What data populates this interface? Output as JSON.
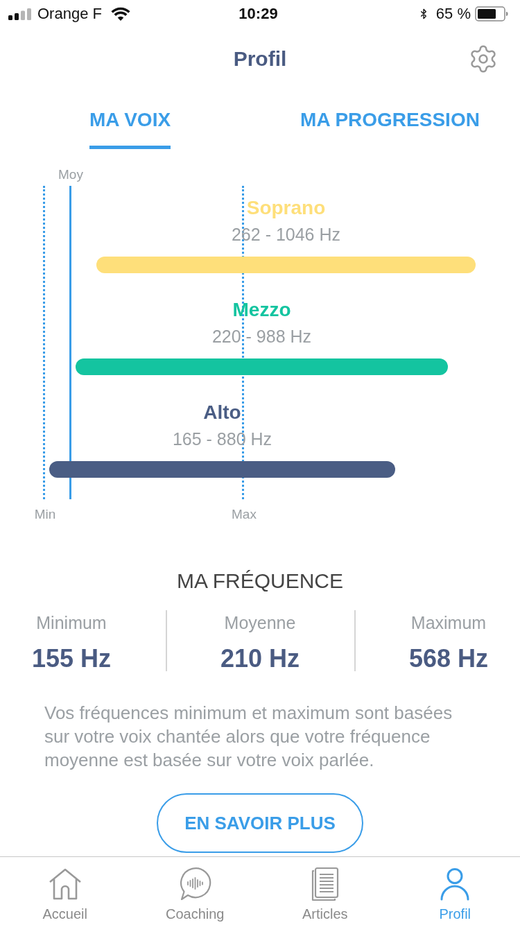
{
  "status_bar": {
    "carrier": "Orange F",
    "time": "10:29",
    "battery": "65 %"
  },
  "header": {
    "title": "Profil"
  },
  "tabs": [
    {
      "label": "MA VOIX",
      "selected": true
    },
    {
      "label": "MA PROGRESSION",
      "selected": false
    }
  ],
  "voice_chart": {
    "markers": [
      {
        "label": "Min",
        "kind": "limit"
      },
      {
        "label": "Moy",
        "kind": "average"
      },
      {
        "label": "Max",
        "kind": "limit"
      }
    ],
    "ranges": [
      {
        "name": "Soprano",
        "range": "262 - 1046 Hz",
        "color": "#fedf7a"
      },
      {
        "name": "Mezzo",
        "range": "220 - 988 Hz",
        "color": "#14c4a0"
      },
      {
        "name": "Alto",
        "range": "165 - 880 Hz",
        "color": "#4a5d84"
      }
    ]
  },
  "frequency": {
    "title": "MA FRÉQUENCE",
    "stats": [
      {
        "label": "Minimum",
        "value": "155 Hz"
      },
      {
        "label": "Moyenne",
        "value": "210 Hz"
      },
      {
        "label": "Maximum",
        "value": "568 Hz"
      }
    ]
  },
  "note": "Vos fréquences minimum et maximum sont basées sur votre voix chantée alors que votre fréquence moyenne est basée sur votre voix parlée.",
  "button": "EN SAVOIR PLUS",
  "tab_bar": [
    {
      "label": "Accueil",
      "selected": false
    },
    {
      "label": "Coaching",
      "selected": false
    },
    {
      "label": "Articles",
      "selected": false
    },
    {
      "label": "Profil",
      "selected": true
    }
  ]
}
